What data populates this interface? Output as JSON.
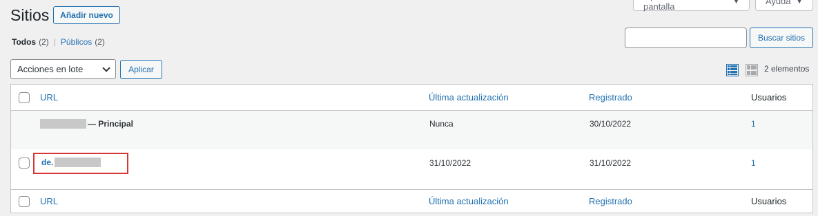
{
  "screen_meta": {
    "screen_options_label": "Opciones de pantalla",
    "help_label": "Ayuda"
  },
  "header": {
    "title": "Sitios",
    "add_new_label": "Añadir nuevo"
  },
  "views": {
    "all_label": "Todos",
    "all_count": "(2)",
    "separator": "|",
    "public_label": "Públicos",
    "public_count": "(2)"
  },
  "search": {
    "value": "",
    "button_label": "Buscar sitios"
  },
  "bulk": {
    "selected": "Acciones en lote",
    "apply_label": "Aplicar"
  },
  "list_info": {
    "count_text": "2 elementos",
    "icons": [
      "list-view-icon",
      "excerpt-view-icon"
    ]
  },
  "table": {
    "columns": [
      "URL",
      "Última actualización",
      "Registrado",
      "Usuarios"
    ],
    "rows": [
      {
        "url_suffix": "— Principal",
        "last_updated": "Nunca",
        "registered": "30/10/2022",
        "users": "1"
      },
      {
        "url_prefix": "de.",
        "last_updated": "31/10/2022",
        "registered": "31/10/2022",
        "users": "1"
      }
    ]
  },
  "colors": {
    "accent": "#2271b1",
    "highlight": "#d63638",
    "background": "#f0f0f1"
  }
}
